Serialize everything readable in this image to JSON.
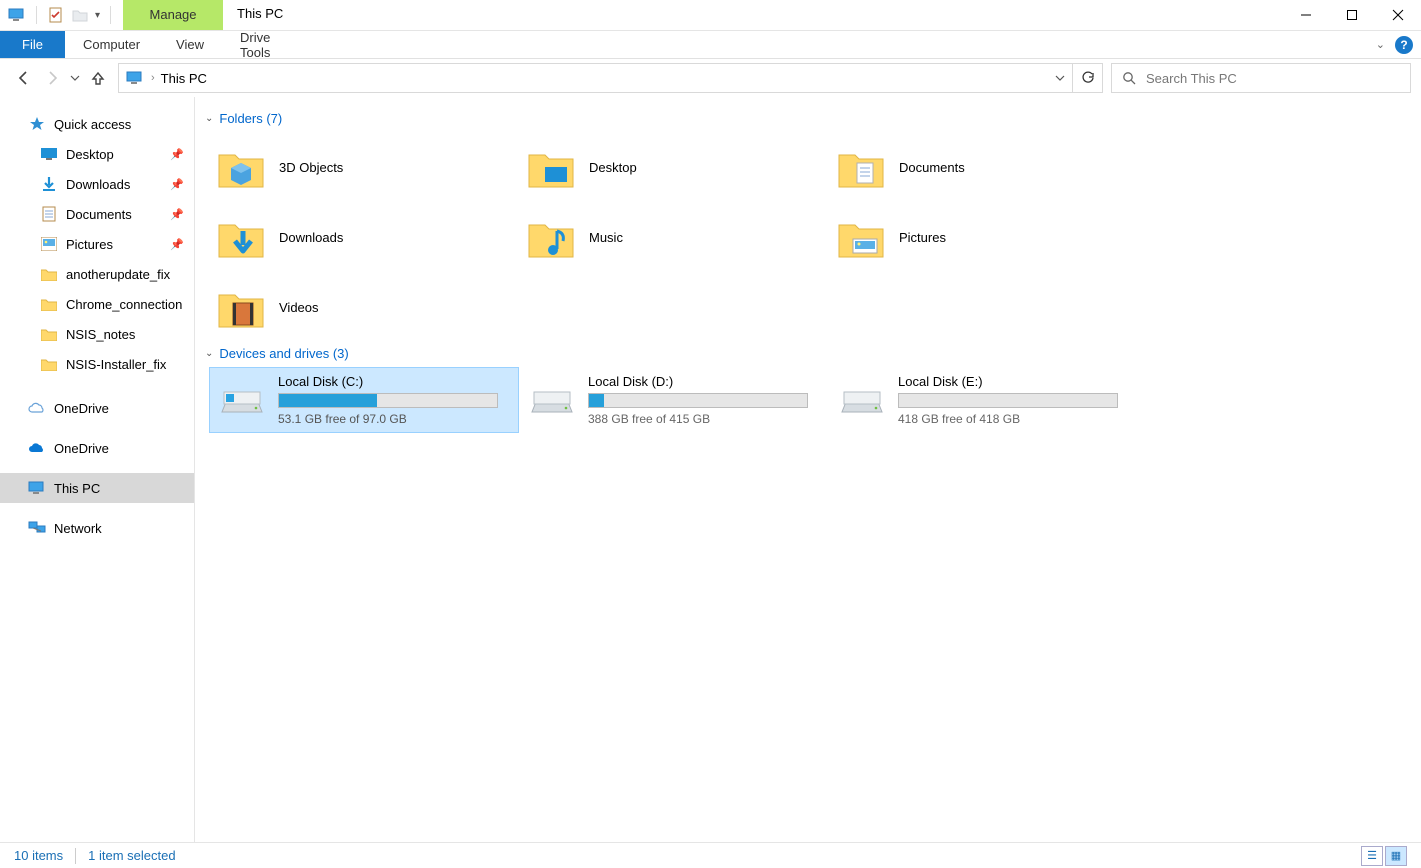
{
  "window": {
    "title": "This PC",
    "context_tab": "Manage",
    "ribbon_tabs": {
      "file": "File",
      "computer": "Computer",
      "view": "View",
      "drive": "Drive Tools"
    }
  },
  "address": {
    "location": "This PC"
  },
  "search": {
    "placeholder": "Search This PC"
  },
  "sidebar": {
    "quick_access": "Quick access",
    "items": [
      {
        "label": "Desktop",
        "pinned": true
      },
      {
        "label": "Downloads",
        "pinned": true
      },
      {
        "label": "Documents",
        "pinned": true
      },
      {
        "label": "Pictures",
        "pinned": true
      },
      {
        "label": "anotherupdate_fix",
        "pinned": false
      },
      {
        "label": "Chrome_connection",
        "pinned": false
      },
      {
        "label": "NSIS_notes",
        "pinned": false
      },
      {
        "label": "NSIS-Installer_fix",
        "pinned": false
      }
    ],
    "onedrive1": "OneDrive",
    "onedrive2": "OneDrive",
    "this_pc": "This PC",
    "network": "Network"
  },
  "sections": {
    "folders": {
      "header": "Folders (7)",
      "items": [
        {
          "label": "3D Objects"
        },
        {
          "label": "Desktop"
        },
        {
          "label": "Documents"
        },
        {
          "label": "Downloads"
        },
        {
          "label": "Music"
        },
        {
          "label": "Pictures"
        },
        {
          "label": "Videos"
        }
      ]
    },
    "drives": {
      "header": "Devices and drives (3)",
      "items": [
        {
          "label": "Local Disk (C:)",
          "free": "53.1 GB free of 97.0 GB",
          "pct": 45,
          "selected": true
        },
        {
          "label": "Local Disk (D:)",
          "free": "388 GB free of 415 GB",
          "pct": 7,
          "selected": false
        },
        {
          "label": "Local Disk (E:)",
          "free": "418 GB free of 418 GB",
          "pct": 0,
          "selected": false
        }
      ]
    }
  },
  "status": {
    "count": "10 items",
    "selected": "1 item selected"
  }
}
